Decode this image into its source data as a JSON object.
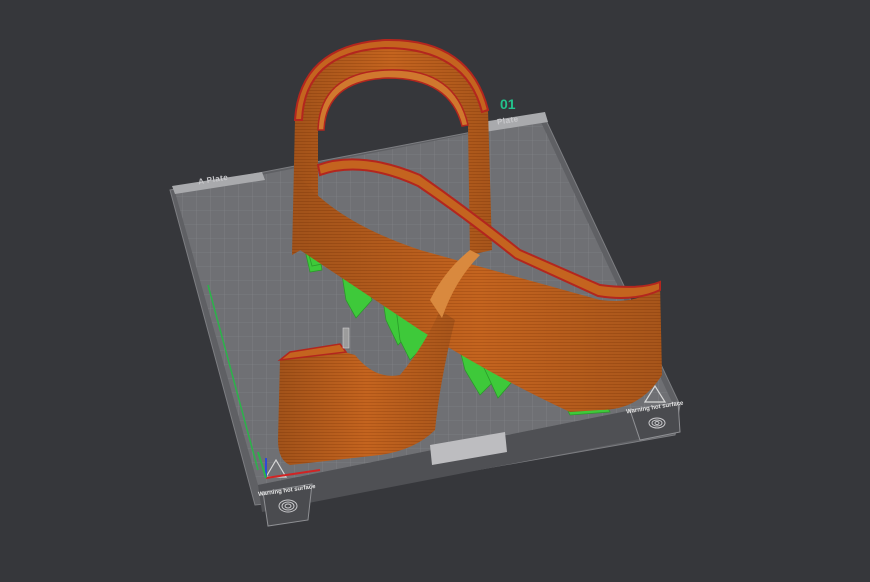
{
  "viewport": {
    "plate_name": "A Plate",
    "plate_name_back": "Plate",
    "plate_number": "01",
    "warning_front_left": "Warning hot surface",
    "warning_front_right": "Warning hot surface"
  },
  "colors": {
    "background": "#36373b",
    "bed": "#6f7074",
    "grid": "#8a8b8f",
    "model": "#c4641f",
    "model_edge": "#b3261e",
    "supports": "#3ec93a",
    "accent_number": "#23c28c"
  },
  "icons": {
    "bed_corner": "hot-surface-warning-icon",
    "bed_front": "fingerprint-icon",
    "axes": "axis-gizmo-icon"
  }
}
